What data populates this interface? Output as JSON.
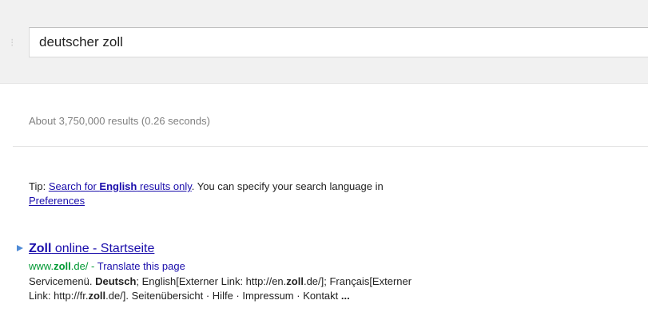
{
  "search": {
    "query": "deutscher zoll"
  },
  "stats": {
    "text": "About 3,750,000 results (0.26 seconds)"
  },
  "tip": {
    "prefix": "Tip: ",
    "link_pre": "Search for ",
    "link_bold": "English",
    "link_post": " results only",
    "middle": ". You can specify your search language in",
    "preferences_label": "Preferences"
  },
  "result": {
    "title_bold": "Zoll",
    "title_rest": " online - Startseite",
    "url_pre": "www.",
    "url_bold": "zoll",
    "url_post": ".de/",
    "url_sep": " - ",
    "translate_label": "Translate this page",
    "snippet": {
      "s1": "Servicemenü. ",
      "b1": "Deutsch",
      "s2": "; English[Externer Link: http://en.",
      "b2": "zoll",
      "s3": ".de/]; Français[Externer",
      "s4": "Link: http://fr.",
      "b3": "zoll",
      "s5": ".de/]. Seitenübersicht · Hilfe · Impressum · Kontakt ",
      "ellipsis": "..."
    }
  },
  "colors": {
    "link": "#1a0dab",
    "url_green": "#009933",
    "stats_gray": "#808080",
    "band_bg": "#f1f1f1"
  },
  "icons": {
    "result_arrow": "triangle-right-icon"
  }
}
